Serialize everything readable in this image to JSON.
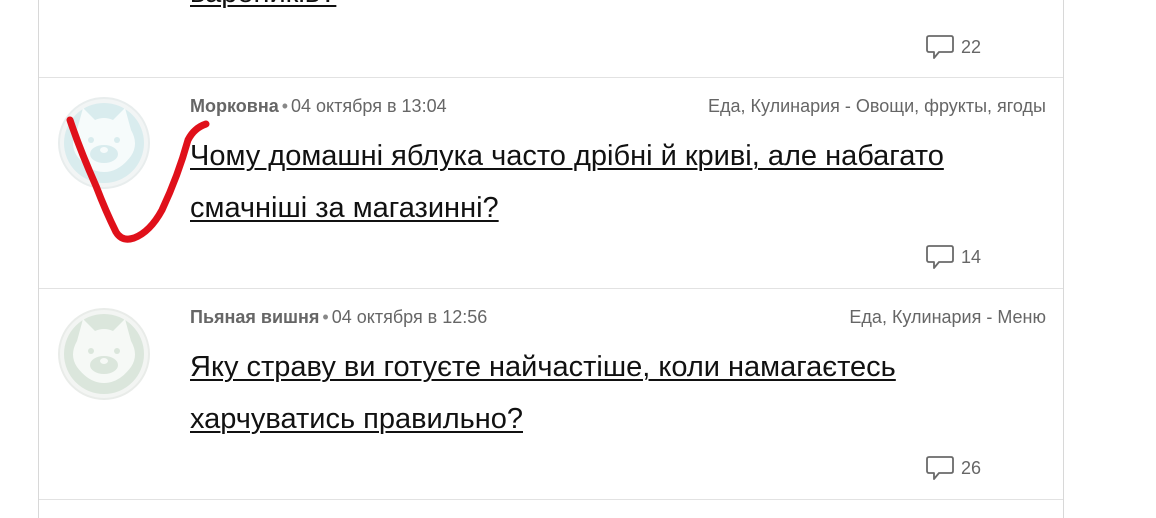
{
  "prev_post": {
    "title": "вареників?",
    "comments": "22"
  },
  "posts": [
    {
      "author": "Морковна",
      "date": "04 октября в 13:04",
      "category": "Еда, Кулинария - Овощи, фрукты, ягоды",
      "title": "Чому домашні яблука часто дрібні й криві, але набагато смачніші за магазинні?",
      "comments": "14"
    },
    {
      "author": "Пьяная вишня",
      "date": "04 октября в 12:56",
      "category": "Еда, Кулинария - Меню",
      "title": "Яку страву ви готуєте найчастіше, коли намагаєтесь харчуватись правильно?",
      "comments": "26"
    }
  ],
  "colors": {
    "meta_text": "#666666",
    "title_text": "#111111",
    "annotation_stroke": "#e0101a"
  },
  "icons": {
    "avatar": "bear-avatar-icon",
    "comments": "comment-bubble-icon"
  }
}
